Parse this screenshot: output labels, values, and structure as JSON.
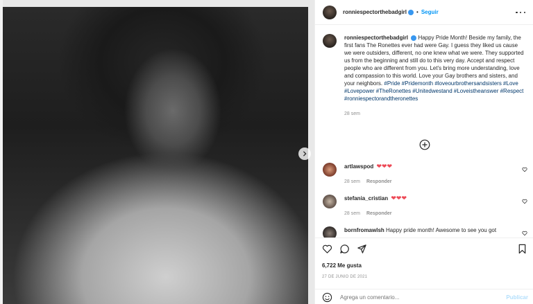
{
  "post": {
    "username": "ronniespectorthebadgirl",
    "follow_label": "Seguir",
    "caption": "Happy Pride Month! Beside my family, the first fans The Ronettes ever had were Gay. I guess they liked us cause we were outsiders, different, no one knew what we were. They supported us from the beginning and still do to this very day. Accept and respect people who are different from you. Let's bring more understanding, love and compassion to this world. Love your Gay brothers and sisters, and your neighbors.",
    "hashtags": "#Pride #Pridemonth #loveourbrothersandsisters #Love #Lovepower #TheRonettes #Unitedwestand #Loveistheanswer #Respect #ronniespectorandtheronettes",
    "caption_time": "28 sem",
    "likes": "6,722 Me gusta",
    "date": "27 DE JUNIO DE 2021"
  },
  "comments": [
    {
      "user": "artlawspod",
      "text": "❤❤❤",
      "time": "28 sem",
      "reply": "Responder"
    },
    {
      "user": "stefania_cristian",
      "text": "❤❤❤",
      "time": "28 sem",
      "reply": "Responder"
    },
    {
      "user": "bornfromawlsh",
      "text": "Happy pride month! Awesome to see you got"
    }
  ],
  "add_comment": {
    "placeholder": "Agrega un comentario...",
    "publish": "Publicar"
  },
  "icons": [
    "next-arrow-icon",
    "more-options-icon",
    "add-circle-icon",
    "heart-icon",
    "comment-icon",
    "share-icon",
    "bookmark-icon",
    "emoji-icon"
  ],
  "colors": {
    "accent": "#0095f6",
    "heart": "#ed4956",
    "muted": "#8e8e8e",
    "text": "#262626"
  }
}
